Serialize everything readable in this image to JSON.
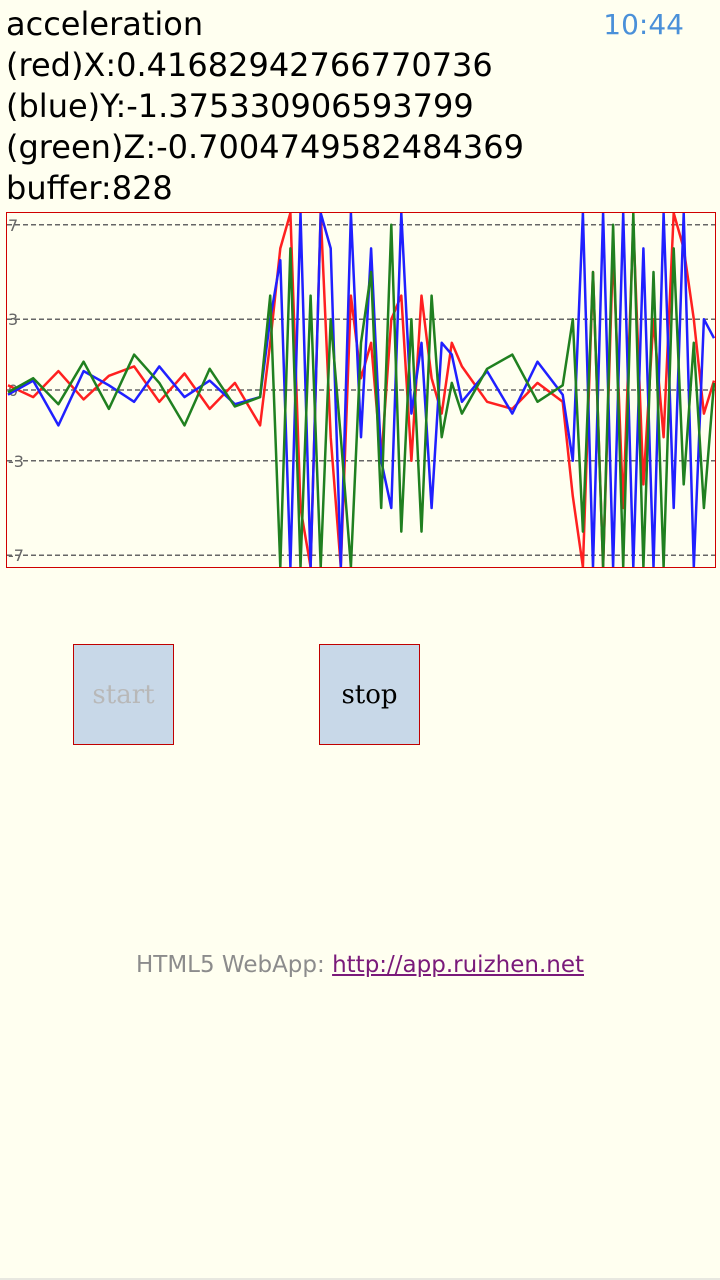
{
  "status_bar": {
    "time": "10:44"
  },
  "readouts": {
    "title": "acceleration",
    "x_line": "(red)X:0.41682942766770736",
    "y_line": "(blue)Y:-1.375330906593799",
    "z_line": "(green)Z:-0.7004749582484369",
    "buffer_line": "buffer:828"
  },
  "buttons": {
    "start_label": "start",
    "stop_label": "stop"
  },
  "footer": {
    "prefix": "HTML5 WebApp: ",
    "link_text": "http://app.ruizhen.net"
  },
  "colors": {
    "x": "#ff2020",
    "y": "#2020ff",
    "z": "#208020",
    "border": "#d00000",
    "background": "#fffff0"
  },
  "chart_data": {
    "type": "line",
    "ylim": [
      -7.5,
      7.5
    ],
    "gridlines": [
      7,
      3,
      0,
      -3,
      -7
    ],
    "tick_labels": [
      "7",
      "3",
      "0",
      "-3",
      "-7"
    ],
    "x": [
      0,
      25,
      50,
      75,
      100,
      125,
      150,
      175,
      200,
      225,
      250,
      260,
      270,
      280,
      290,
      300,
      310,
      320,
      330,
      340,
      350,
      360,
      370,
      380,
      390,
      400,
      410,
      420,
      430,
      440,
      450,
      475,
      500,
      525,
      550,
      560,
      570,
      580,
      590,
      600,
      610,
      620,
      630,
      640,
      650,
      660,
      670,
      680,
      690,
      700
    ],
    "series": [
      {
        "values": [
          0.2,
          -0.3,
          0.8,
          -0.4,
          0.6,
          1.0,
          -0.5,
          0.7,
          -0.8,
          0.3,
          -1.5,
          2.0,
          6.0,
          8.0,
          -5.0,
          -7.8,
          8.0,
          -2.0,
          -7.8,
          4.0,
          0.5,
          2.0,
          -3.0,
          3.0,
          4.0,
          -3.0,
          4.0,
          0.5,
          -1.0,
          2.0,
          1.0,
          -0.5,
          -0.8,
          0.3,
          -0.5,
          -4.5,
          -7.8,
          5.0,
          -7.8,
          6.0,
          -5.0,
          7.0,
          -4.0,
          3.0,
          -2.0,
          7.5,
          6.0,
          3.0,
          -1.0,
          0.4
        ]
      },
      {
        "values": [
          -0.2,
          0.4,
          -1.5,
          0.8,
          0.2,
          -0.5,
          1.0,
          -0.3,
          0.4,
          -0.6,
          -0.3,
          3.0,
          5.5,
          -7.8,
          8.0,
          -7.8,
          8.0,
          6.0,
          -7.8,
          8.0,
          -2.0,
          6.0,
          -3.0,
          -5.0,
          7.5,
          -1.0,
          2.0,
          -5.0,
          2.0,
          1.5,
          -0.5,
          0.8,
          -1.0,
          1.2,
          -0.2,
          -3.0,
          8.0,
          -7.8,
          8.0,
          -7.8,
          8.0,
          -7.8,
          6.0,
          -7.8,
          8.0,
          -5.0,
          8.0,
          -7.8,
          3.0,
          2.2
        ]
      },
      {
        "values": [
          -0.1,
          0.5,
          -0.6,
          1.2,
          -0.8,
          1.5,
          0.3,
          -1.5,
          0.9,
          -0.7,
          -0.3,
          4.0,
          -7.8,
          6.0,
          -7.8,
          4.0,
          -7.8,
          3.0,
          -2.0,
          -7.8,
          2.0,
          5.0,
          -5.0,
          7.0,
          -6.0,
          3.0,
          -6.0,
          4.0,
          -2.0,
          0.3,
          -1.0,
          0.9,
          1.5,
          -0.5,
          0.2,
          3.0,
          -6.0,
          5.0,
          -7.8,
          7.0,
          -7.8,
          8.0,
          -7.8,
          5.0,
          -7.8,
          6.0,
          -4.0,
          2.0,
          -5.0,
          0.3
        ]
      }
    ]
  }
}
